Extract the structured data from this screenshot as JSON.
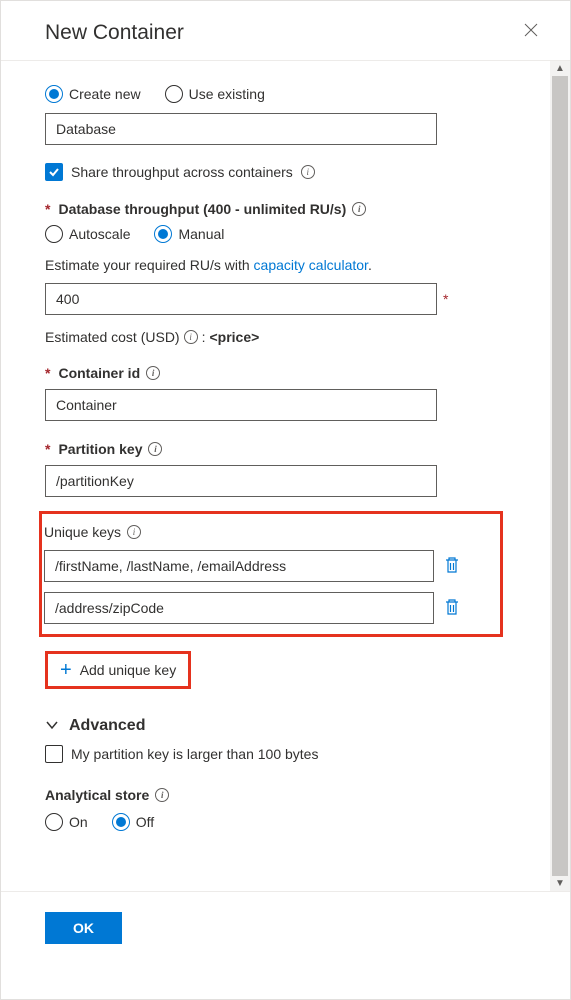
{
  "header": {
    "title": "New Container"
  },
  "dbMode": {
    "createNew": "Create new",
    "useExisting": "Use existing"
  },
  "dbName": {
    "value": "Database"
  },
  "shareThroughput": {
    "label": "Share throughput across containers"
  },
  "throughput": {
    "label": "Database throughput (400 - unlimited RU/s)",
    "autoscale": "Autoscale",
    "manual": "Manual",
    "hint_pre": "Estimate your required RU/s with ",
    "hint_link": "capacity calculator",
    "hint_post": ".",
    "value": "400",
    "estLabel": "Estimated cost (USD)",
    "estColon": ": ",
    "estPrice": "<price>"
  },
  "containerId": {
    "label": "Container id",
    "value": "Container"
  },
  "partitionKey": {
    "label": "Partition key",
    "value": "/partitionKey"
  },
  "uniqueKeys": {
    "label": "Unique keys",
    "items": [
      "/firstName, /lastName, /emailAddress",
      "/address/zipCode"
    ],
    "addLabel": "Add unique key"
  },
  "advanced": {
    "title": "Advanced",
    "pkLarge": "My partition key is larger than 100 bytes"
  },
  "analyticalStore": {
    "label": "Analytical store",
    "on": "On",
    "off": "Off"
  },
  "footer": {
    "ok": "OK"
  }
}
